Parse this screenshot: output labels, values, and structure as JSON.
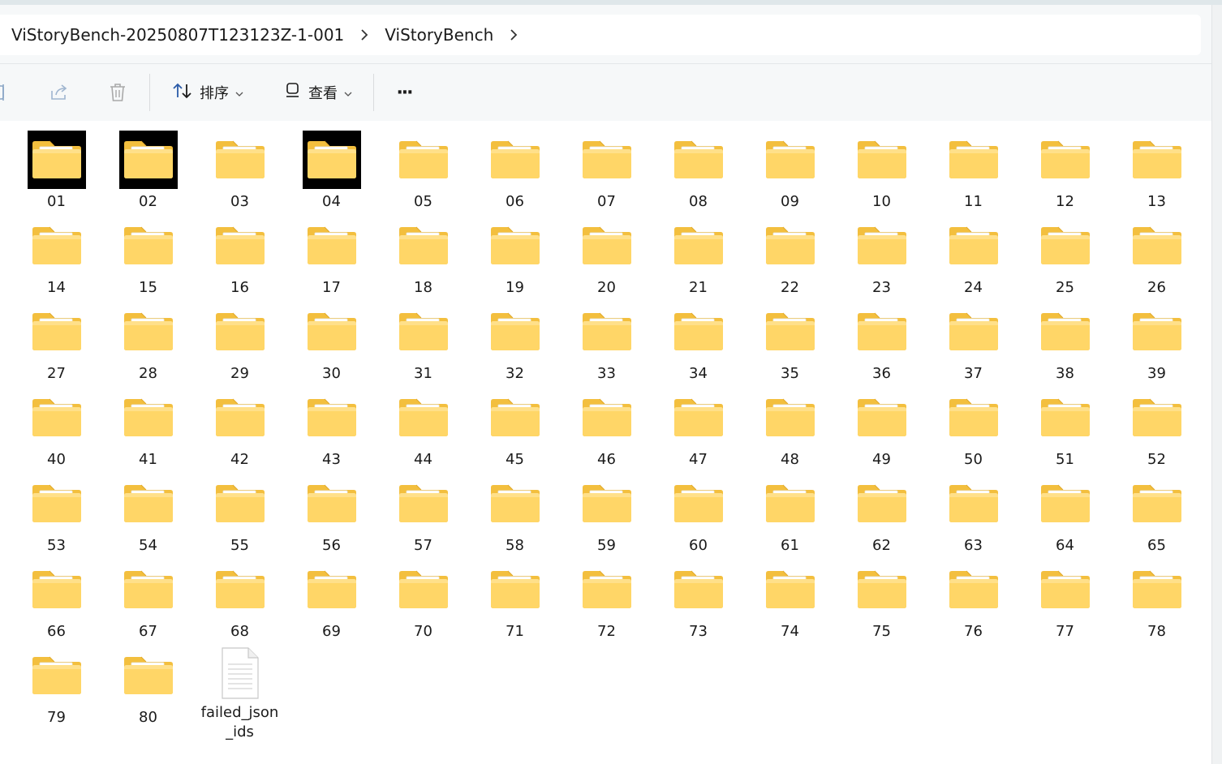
{
  "breadcrumb": {
    "items": [
      "ViStoryBench-20250807T123123Z-1-001",
      "ViStoryBench"
    ]
  },
  "toolbar": {
    "sort_label": "排序",
    "view_label": "查看",
    "more_label": "···"
  },
  "files": [
    {
      "name": "01",
      "type": "folder",
      "dark": true
    },
    {
      "name": "02",
      "type": "folder",
      "dark": true
    },
    {
      "name": "03",
      "type": "folder",
      "dark": false
    },
    {
      "name": "04",
      "type": "folder",
      "dark": true
    },
    {
      "name": "05",
      "type": "folder",
      "dark": false
    },
    {
      "name": "06",
      "type": "folder",
      "dark": false
    },
    {
      "name": "07",
      "type": "folder",
      "dark": false
    },
    {
      "name": "08",
      "type": "folder",
      "dark": false
    },
    {
      "name": "09",
      "type": "folder",
      "dark": false
    },
    {
      "name": "10",
      "type": "folder",
      "dark": false
    },
    {
      "name": "11",
      "type": "folder",
      "dark": false
    },
    {
      "name": "12",
      "type": "folder",
      "dark": false
    },
    {
      "name": "13",
      "type": "folder",
      "dark": false
    },
    {
      "name": "14",
      "type": "folder",
      "dark": false
    },
    {
      "name": "15",
      "type": "folder",
      "dark": false
    },
    {
      "name": "16",
      "type": "folder",
      "dark": false
    },
    {
      "name": "17",
      "type": "folder",
      "dark": false
    },
    {
      "name": "18",
      "type": "folder",
      "dark": false
    },
    {
      "name": "19",
      "type": "folder",
      "dark": false
    },
    {
      "name": "20",
      "type": "folder",
      "dark": false
    },
    {
      "name": "21",
      "type": "folder",
      "dark": false
    },
    {
      "name": "22",
      "type": "folder",
      "dark": false
    },
    {
      "name": "23",
      "type": "folder",
      "dark": false
    },
    {
      "name": "24",
      "type": "folder",
      "dark": false
    },
    {
      "name": "25",
      "type": "folder",
      "dark": false
    },
    {
      "name": "26",
      "type": "folder",
      "dark": false
    },
    {
      "name": "27",
      "type": "folder",
      "dark": false
    },
    {
      "name": "28",
      "type": "folder",
      "dark": false
    },
    {
      "name": "29",
      "type": "folder",
      "dark": false
    },
    {
      "name": "30",
      "type": "folder",
      "dark": false
    },
    {
      "name": "31",
      "type": "folder",
      "dark": false
    },
    {
      "name": "32",
      "type": "folder",
      "dark": false
    },
    {
      "name": "33",
      "type": "folder",
      "dark": false
    },
    {
      "name": "34",
      "type": "folder",
      "dark": false
    },
    {
      "name": "35",
      "type": "folder",
      "dark": false
    },
    {
      "name": "36",
      "type": "folder",
      "dark": false
    },
    {
      "name": "37",
      "type": "folder",
      "dark": false
    },
    {
      "name": "38",
      "type": "folder",
      "dark": false
    },
    {
      "name": "39",
      "type": "folder",
      "dark": false
    },
    {
      "name": "40",
      "type": "folder",
      "dark": false
    },
    {
      "name": "41",
      "type": "folder",
      "dark": false
    },
    {
      "name": "42",
      "type": "folder",
      "dark": false
    },
    {
      "name": "43",
      "type": "folder",
      "dark": false
    },
    {
      "name": "44",
      "type": "folder",
      "dark": false
    },
    {
      "name": "45",
      "type": "folder",
      "dark": false
    },
    {
      "name": "46",
      "type": "folder",
      "dark": false
    },
    {
      "name": "47",
      "type": "folder",
      "dark": false
    },
    {
      "name": "48",
      "type": "folder",
      "dark": false
    },
    {
      "name": "49",
      "type": "folder",
      "dark": false
    },
    {
      "name": "50",
      "type": "folder",
      "dark": false
    },
    {
      "name": "51",
      "type": "folder",
      "dark": false
    },
    {
      "name": "52",
      "type": "folder",
      "dark": false
    },
    {
      "name": "53",
      "type": "folder",
      "dark": false
    },
    {
      "name": "54",
      "type": "folder",
      "dark": false
    },
    {
      "name": "55",
      "type": "folder",
      "dark": false
    },
    {
      "name": "56",
      "type": "folder",
      "dark": false
    },
    {
      "name": "57",
      "type": "folder",
      "dark": false
    },
    {
      "name": "58",
      "type": "folder",
      "dark": false
    },
    {
      "name": "59",
      "type": "folder",
      "dark": false
    },
    {
      "name": "60",
      "type": "folder",
      "dark": false
    },
    {
      "name": "61",
      "type": "folder",
      "dark": false
    },
    {
      "name": "62",
      "type": "folder",
      "dark": false
    },
    {
      "name": "63",
      "type": "folder",
      "dark": false
    },
    {
      "name": "64",
      "type": "folder",
      "dark": false
    },
    {
      "name": "65",
      "type": "folder",
      "dark": false
    },
    {
      "name": "66",
      "type": "folder",
      "dark": false
    },
    {
      "name": "67",
      "type": "folder",
      "dark": false
    },
    {
      "name": "68",
      "type": "folder",
      "dark": false
    },
    {
      "name": "69",
      "type": "folder",
      "dark": false
    },
    {
      "name": "70",
      "type": "folder",
      "dark": false
    },
    {
      "name": "71",
      "type": "folder",
      "dark": false
    },
    {
      "name": "72",
      "type": "folder",
      "dark": false
    },
    {
      "name": "73",
      "type": "folder",
      "dark": false
    },
    {
      "name": "74",
      "type": "folder",
      "dark": false
    },
    {
      "name": "75",
      "type": "folder",
      "dark": false
    },
    {
      "name": "76",
      "type": "folder",
      "dark": false
    },
    {
      "name": "77",
      "type": "folder",
      "dark": false
    },
    {
      "name": "78",
      "type": "folder",
      "dark": false
    },
    {
      "name": "79",
      "type": "folder",
      "dark": false
    },
    {
      "name": "80",
      "type": "folder",
      "dark": false
    },
    {
      "name": "failed_json_ids",
      "type": "file",
      "dark": false
    }
  ],
  "colors": {
    "folder_back": "#f6c23e",
    "folder_front": "#ffd96a",
    "chrome_bg": "#f6f8f9"
  }
}
